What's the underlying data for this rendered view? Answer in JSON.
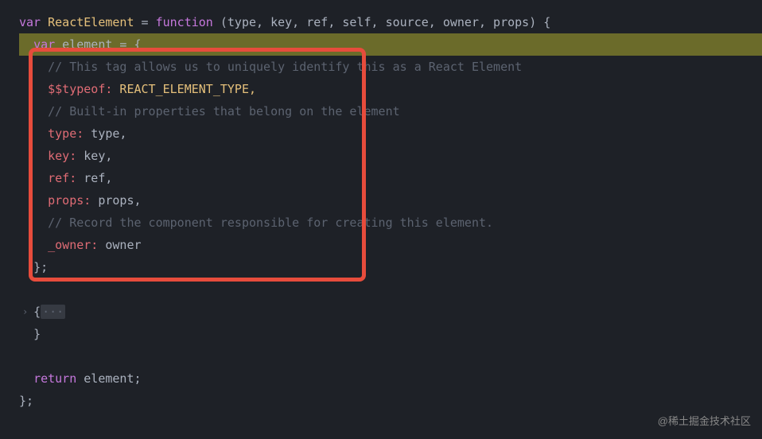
{
  "code": {
    "line1": {
      "kw1": "var",
      "name": "ReactElement",
      "eq": " = ",
      "kw2": "function",
      "params": " (type, key, ref, self, source, owner, props) {"
    },
    "line2": {
      "kw": "var",
      "name": " element",
      "rest": " = {"
    },
    "line3": "// This tag allows us to uniquely identify this as a React Element",
    "line4": {
      "prop": "$$typeof:",
      "val": " REACT_ELEMENT_TYPE,"
    },
    "line5": "// Built-in properties that belong on the element",
    "line6": {
      "prop": "type:",
      "val": " type,"
    },
    "line7": {
      "prop": "key:",
      "val": " key,"
    },
    "line8": {
      "prop": "ref:",
      "val": " ref,"
    },
    "line9": {
      "prop": "props:",
      "val": " props,"
    },
    "line10": "// Record the component responsible for creating this element.",
    "line11": {
      "prop": "_owner:",
      "val": " owner"
    },
    "line12": "};",
    "line13": "{",
    "line13_fold": "···",
    "line14": "}",
    "line15_kw": "return",
    "line15_val": " element;",
    "line16": "};"
  },
  "watermark": "@稀土掘金技术社区",
  "fold_icon": "›"
}
